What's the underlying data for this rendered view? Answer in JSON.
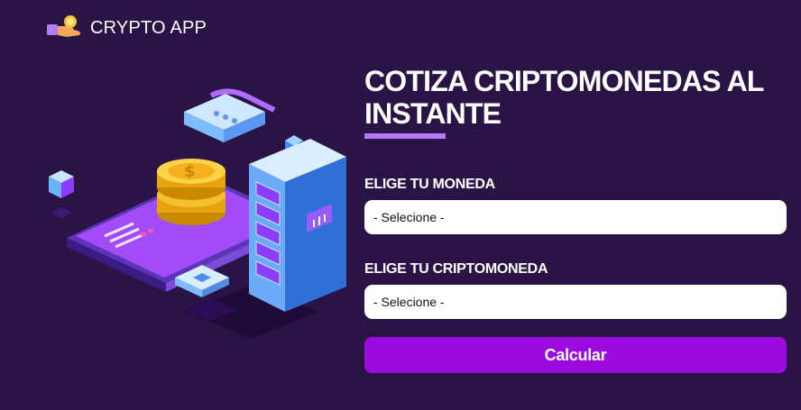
{
  "brand": {
    "name": "CRYPTO APP",
    "accent": "#9b0bde",
    "background": "#2a1446"
  },
  "form": {
    "title": "COTIZA CRIPTOMONEDAS AL INSTANTE",
    "currency": {
      "label": "ELIGE TU MONEDA",
      "value": "- Selecione -"
    },
    "crypto": {
      "label": "ELIGE TU CRIPTOMONEDA",
      "value": "- Selecione -"
    },
    "submit_label": "Calcular"
  },
  "icons": {
    "logo": "hand-coin-icon",
    "illustration": "crypto-phone-server-illustration"
  }
}
